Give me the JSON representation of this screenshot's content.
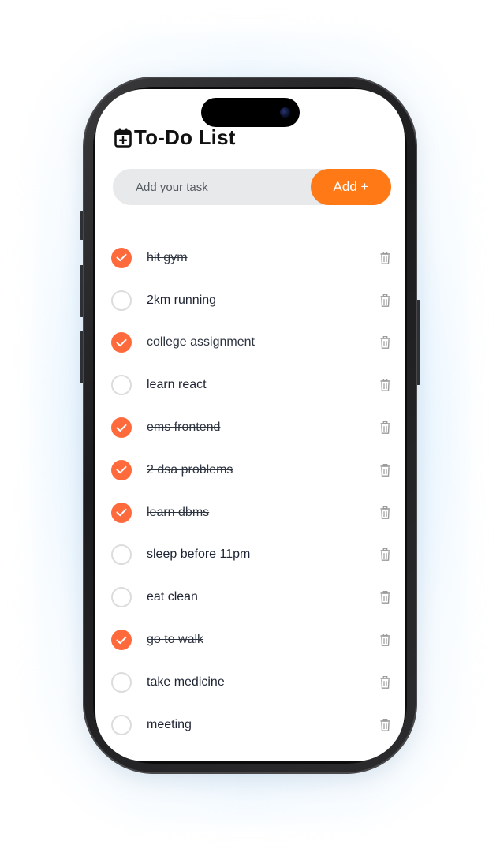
{
  "app": {
    "title": "To-Do List",
    "title_icon": "calendar-plus-icon"
  },
  "input": {
    "value": "",
    "placeholder": "Add your task"
  },
  "add_button": {
    "label": "Add +"
  },
  "colors": {
    "accent": "#ff7a17",
    "check": "#ff6a3d",
    "input_bg": "#e8e9eb",
    "text": "#1e2433"
  },
  "tasks": [
    {
      "text": "hit gym",
      "done": true
    },
    {
      "text": "2km running",
      "done": false
    },
    {
      "text": "college assignment",
      "done": true
    },
    {
      "text": "learn react",
      "done": false
    },
    {
      "text": "ems frontend",
      "done": true
    },
    {
      "text": "2 dsa problems",
      "done": true
    },
    {
      "text": "learn dbms",
      "done": true
    },
    {
      "text": "sleep before 11pm",
      "done": false
    },
    {
      "text": "eat clean",
      "done": false
    },
    {
      "text": "go to walk",
      "done": true
    },
    {
      "text": "take medicine",
      "done": false
    },
    {
      "text": "meeting",
      "done": false
    }
  ],
  "icons": {
    "check": "check-icon",
    "delete": "trash-icon"
  }
}
